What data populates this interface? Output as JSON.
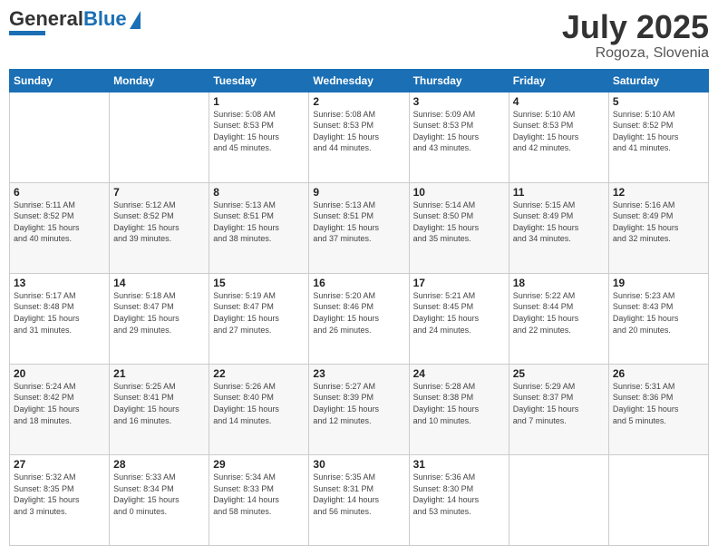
{
  "header": {
    "logo_text_general": "General",
    "logo_text_blue": "Blue",
    "title": "July 2025",
    "location": "Rogoza, Slovenia"
  },
  "weekdays": [
    "Sunday",
    "Monday",
    "Tuesday",
    "Wednesday",
    "Thursday",
    "Friday",
    "Saturday"
  ],
  "weeks": [
    [
      {
        "day": "",
        "info": ""
      },
      {
        "day": "",
        "info": ""
      },
      {
        "day": "1",
        "info": "Sunrise: 5:08 AM\nSunset: 8:53 PM\nDaylight: 15 hours\nand 45 minutes."
      },
      {
        "day": "2",
        "info": "Sunrise: 5:08 AM\nSunset: 8:53 PM\nDaylight: 15 hours\nand 44 minutes."
      },
      {
        "day": "3",
        "info": "Sunrise: 5:09 AM\nSunset: 8:53 PM\nDaylight: 15 hours\nand 43 minutes."
      },
      {
        "day": "4",
        "info": "Sunrise: 5:10 AM\nSunset: 8:53 PM\nDaylight: 15 hours\nand 42 minutes."
      },
      {
        "day": "5",
        "info": "Sunrise: 5:10 AM\nSunset: 8:52 PM\nDaylight: 15 hours\nand 41 minutes."
      }
    ],
    [
      {
        "day": "6",
        "info": "Sunrise: 5:11 AM\nSunset: 8:52 PM\nDaylight: 15 hours\nand 40 minutes."
      },
      {
        "day": "7",
        "info": "Sunrise: 5:12 AM\nSunset: 8:52 PM\nDaylight: 15 hours\nand 39 minutes."
      },
      {
        "day": "8",
        "info": "Sunrise: 5:13 AM\nSunset: 8:51 PM\nDaylight: 15 hours\nand 38 minutes."
      },
      {
        "day": "9",
        "info": "Sunrise: 5:13 AM\nSunset: 8:51 PM\nDaylight: 15 hours\nand 37 minutes."
      },
      {
        "day": "10",
        "info": "Sunrise: 5:14 AM\nSunset: 8:50 PM\nDaylight: 15 hours\nand 35 minutes."
      },
      {
        "day": "11",
        "info": "Sunrise: 5:15 AM\nSunset: 8:49 PM\nDaylight: 15 hours\nand 34 minutes."
      },
      {
        "day": "12",
        "info": "Sunrise: 5:16 AM\nSunset: 8:49 PM\nDaylight: 15 hours\nand 32 minutes."
      }
    ],
    [
      {
        "day": "13",
        "info": "Sunrise: 5:17 AM\nSunset: 8:48 PM\nDaylight: 15 hours\nand 31 minutes."
      },
      {
        "day": "14",
        "info": "Sunrise: 5:18 AM\nSunset: 8:47 PM\nDaylight: 15 hours\nand 29 minutes."
      },
      {
        "day": "15",
        "info": "Sunrise: 5:19 AM\nSunset: 8:47 PM\nDaylight: 15 hours\nand 27 minutes."
      },
      {
        "day": "16",
        "info": "Sunrise: 5:20 AM\nSunset: 8:46 PM\nDaylight: 15 hours\nand 26 minutes."
      },
      {
        "day": "17",
        "info": "Sunrise: 5:21 AM\nSunset: 8:45 PM\nDaylight: 15 hours\nand 24 minutes."
      },
      {
        "day": "18",
        "info": "Sunrise: 5:22 AM\nSunset: 8:44 PM\nDaylight: 15 hours\nand 22 minutes."
      },
      {
        "day": "19",
        "info": "Sunrise: 5:23 AM\nSunset: 8:43 PM\nDaylight: 15 hours\nand 20 minutes."
      }
    ],
    [
      {
        "day": "20",
        "info": "Sunrise: 5:24 AM\nSunset: 8:42 PM\nDaylight: 15 hours\nand 18 minutes."
      },
      {
        "day": "21",
        "info": "Sunrise: 5:25 AM\nSunset: 8:41 PM\nDaylight: 15 hours\nand 16 minutes."
      },
      {
        "day": "22",
        "info": "Sunrise: 5:26 AM\nSunset: 8:40 PM\nDaylight: 15 hours\nand 14 minutes."
      },
      {
        "day": "23",
        "info": "Sunrise: 5:27 AM\nSunset: 8:39 PM\nDaylight: 15 hours\nand 12 minutes."
      },
      {
        "day": "24",
        "info": "Sunrise: 5:28 AM\nSunset: 8:38 PM\nDaylight: 15 hours\nand 10 minutes."
      },
      {
        "day": "25",
        "info": "Sunrise: 5:29 AM\nSunset: 8:37 PM\nDaylight: 15 hours\nand 7 minutes."
      },
      {
        "day": "26",
        "info": "Sunrise: 5:31 AM\nSunset: 8:36 PM\nDaylight: 15 hours\nand 5 minutes."
      }
    ],
    [
      {
        "day": "27",
        "info": "Sunrise: 5:32 AM\nSunset: 8:35 PM\nDaylight: 15 hours\nand 3 minutes."
      },
      {
        "day": "28",
        "info": "Sunrise: 5:33 AM\nSunset: 8:34 PM\nDaylight: 15 hours\nand 0 minutes."
      },
      {
        "day": "29",
        "info": "Sunrise: 5:34 AM\nSunset: 8:33 PM\nDaylight: 14 hours\nand 58 minutes."
      },
      {
        "day": "30",
        "info": "Sunrise: 5:35 AM\nSunset: 8:31 PM\nDaylight: 14 hours\nand 56 minutes."
      },
      {
        "day": "31",
        "info": "Sunrise: 5:36 AM\nSunset: 8:30 PM\nDaylight: 14 hours\nand 53 minutes."
      },
      {
        "day": "",
        "info": ""
      },
      {
        "day": "",
        "info": ""
      }
    ]
  ]
}
